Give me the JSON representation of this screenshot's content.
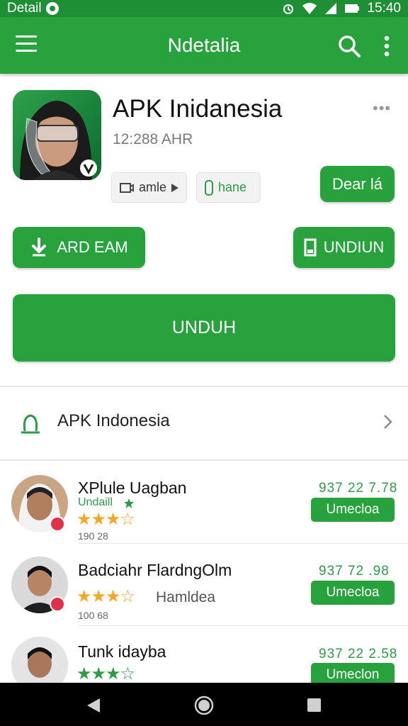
{
  "status_bar": {
    "left_text": "Detail",
    "time": "15:40"
  },
  "app_bar": {
    "title": "Ndetalia"
  },
  "app": {
    "name": "APK Inidanesia",
    "size": "12:288 AHR",
    "chips": {
      "game": "amle",
      "hane": "hane"
    },
    "detail_button": "Dear lá",
    "ard_button": "ARD EAM",
    "unduh_small_button": "UNDIUN",
    "unduh_big_button": "UNDUH"
  },
  "developer": {
    "label": "APK Indonesia"
  },
  "list": [
    {
      "name": "XPlule Uagban",
      "sub": "Undaill",
      "stars": "★★★☆",
      "rating": 3.5,
      "extra": "",
      "count": "190 28",
      "size": "937 22 7.78",
      "button": "Umecloa"
    },
    {
      "name": "Badciahr FlardngOlm",
      "sub": "",
      "stars": "★★★☆",
      "rating": 3.5,
      "extra": "Hamldea",
      "count": "100 68",
      "size": "937 72 .98",
      "button": "Umecloa"
    },
    {
      "name": "Tunk idayba",
      "sub": "",
      "stars": "★★★☆",
      "rating": 3.5,
      "extra": "",
      "count": "",
      "size": "937 22 2.58",
      "button": "Umeclon"
    }
  ],
  "colors": {
    "primary": "#27a23c",
    "status": "#1f8f35",
    "star_gold": "#f5a623",
    "text_green": "#2e9b46"
  }
}
